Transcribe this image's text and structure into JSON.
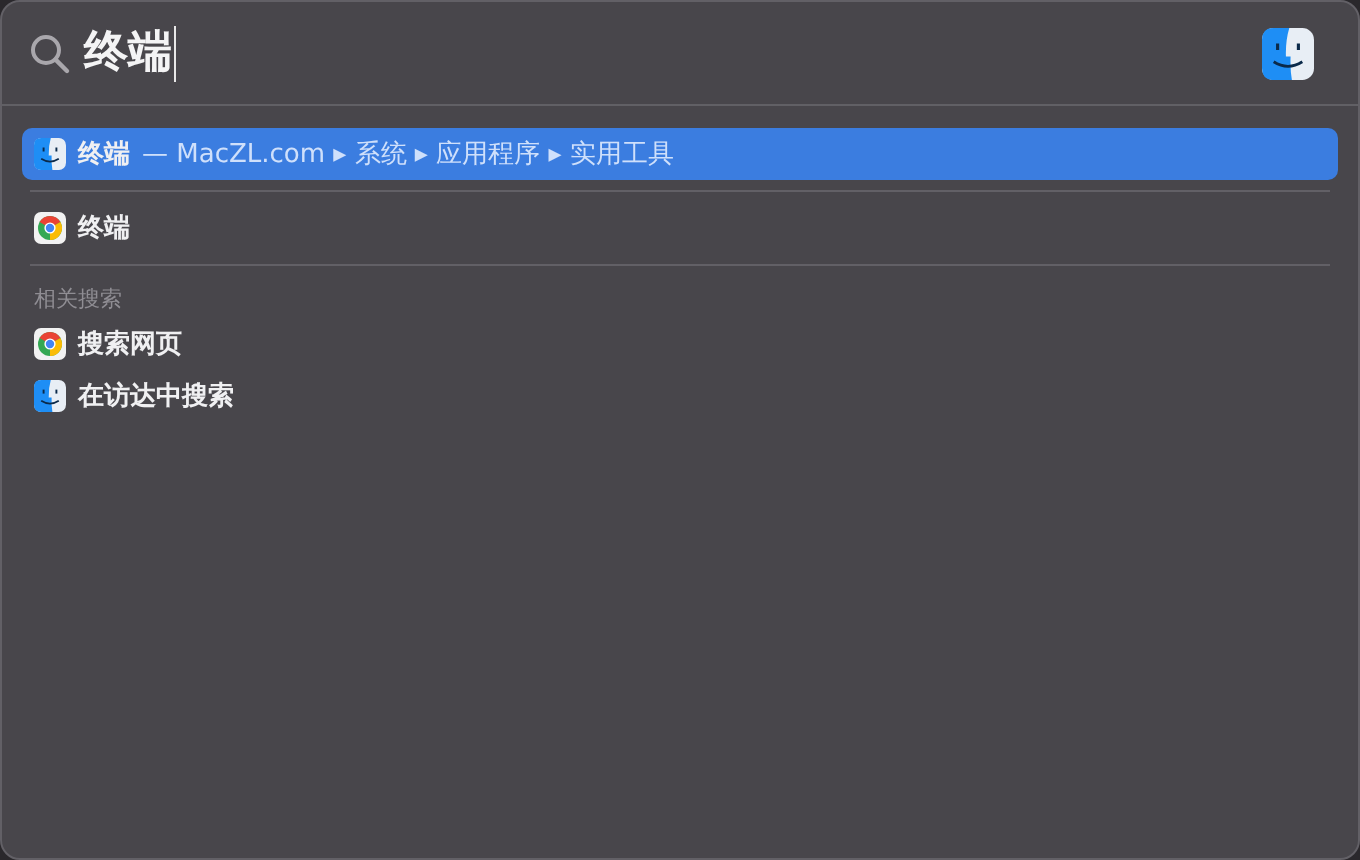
{
  "search": {
    "value": "终端"
  },
  "top_hits": [
    {
      "kind": "finder",
      "title": "终端",
      "path": "— MacZL.com ▸ 系统 ▸ 应用程序 ▸ 实用工具",
      "selected": true
    }
  ],
  "results": [
    {
      "kind": "browser",
      "title": "终端",
      "selected": false
    }
  ],
  "related": {
    "header": "相关搜索",
    "items": [
      {
        "kind": "browser",
        "title": "搜索网页",
        "selected": false
      },
      {
        "kind": "finder",
        "title": "在访达中搜索",
        "selected": false
      }
    ]
  }
}
